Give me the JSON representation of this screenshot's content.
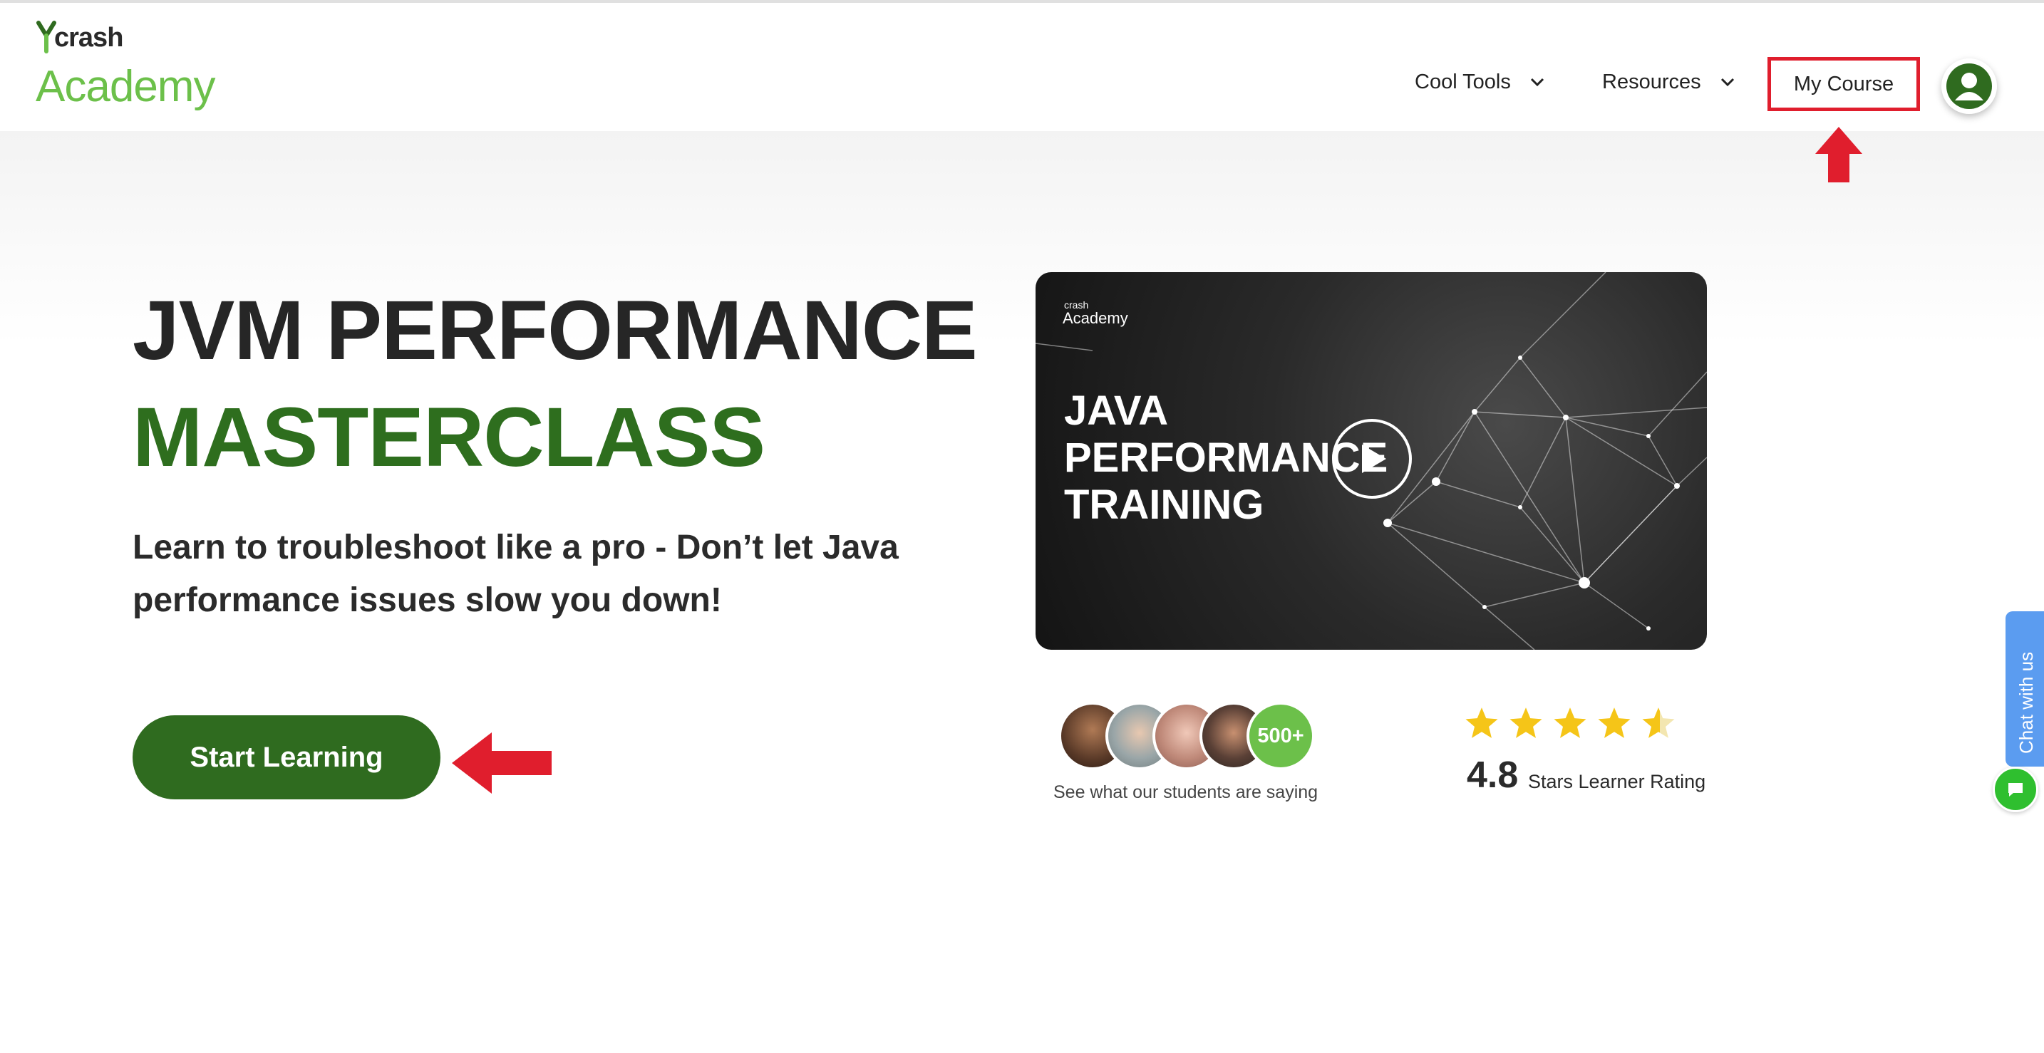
{
  "logo": {
    "brand_small": "crash",
    "brand_large": "Academy"
  },
  "nav": {
    "cool_tools": "Cool Tools",
    "resources": "Resources",
    "my_course": "My Course"
  },
  "hero": {
    "title_line1": "JVM PERFORMANCE",
    "title_line2": "MASTERCLASS",
    "subtitle": "Learn to troubleshoot like a pro - Don’t let Java performance issues slow you down!",
    "cta": "Start Learning"
  },
  "video": {
    "logo_small": "crash",
    "logo_large": "Academy",
    "line1": "JAVA",
    "line2": "PERFORMANCE",
    "line3": "TRAINING"
  },
  "social": {
    "count": "500+",
    "caption": "See what our students are saying"
  },
  "rating": {
    "value": "4.8",
    "label": "Stars Learner Rating",
    "stars": 4.5
  },
  "chat": {
    "tab_label": "Chat with us"
  },
  "colors": {
    "brand_green": "#6cc04a",
    "dark_green": "#2e6e1e",
    "highlight_red": "#e01e2d",
    "star_yellow": "#f5c518",
    "chat_blue": "#5b9cf0"
  }
}
